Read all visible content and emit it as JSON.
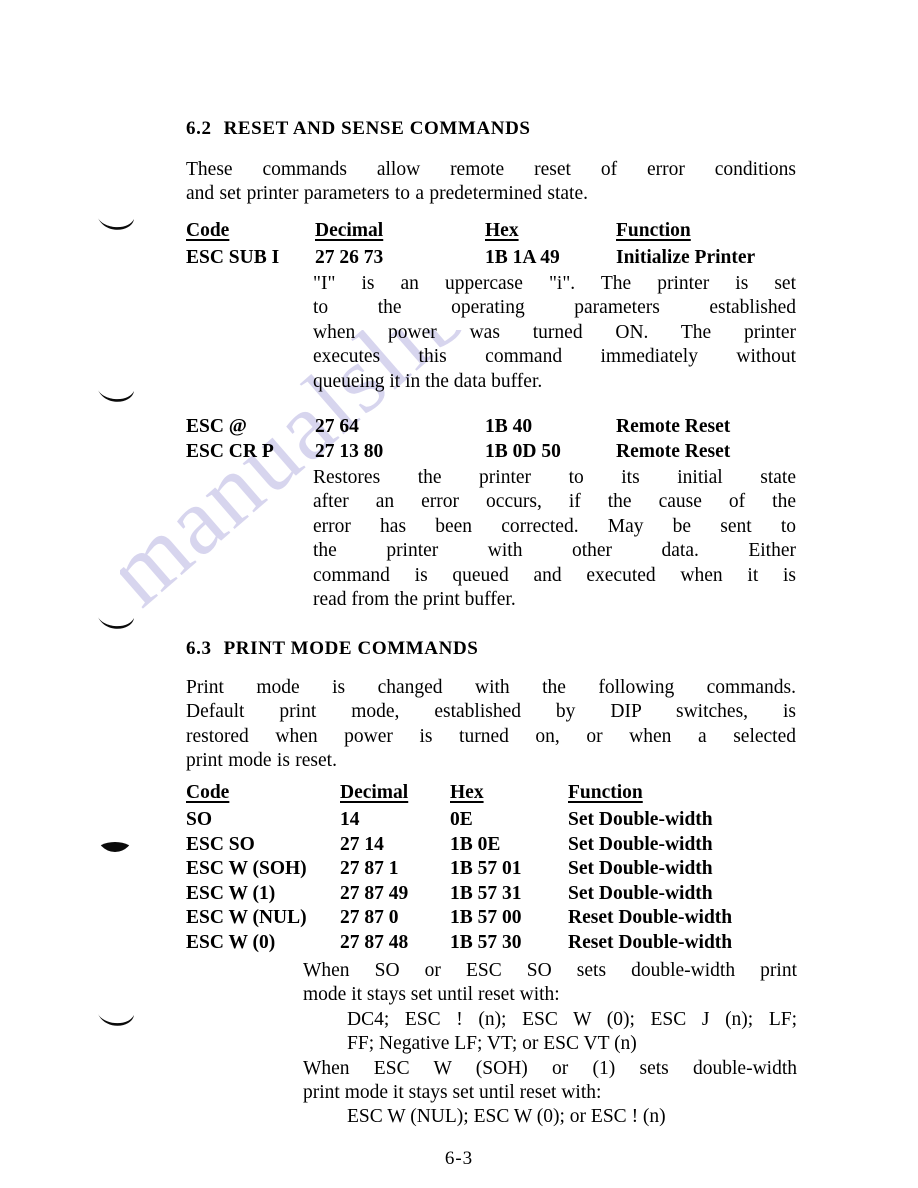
{
  "watermark": {
    "text": "manualslib.com"
  },
  "footer": {
    "page_number": "6-3"
  },
  "sections": {
    "reset_sense": {
      "number": "6.2",
      "title": "RESET AND SENSE COMMANDS",
      "intro": {
        "line1": "These commands allow remote reset of error conditions",
        "line2": "and set printer parameters to a predetermined state."
      },
      "table": {
        "headers": {
          "code": "Code",
          "decimal": "Decimal",
          "hex": "Hex",
          "function": "Function"
        },
        "rows": [
          {
            "code": "ESC SUB I",
            "decimal": "27 26 73",
            "hex": "1B 1A 49",
            "function": "Initialize Printer"
          }
        ],
        "rows2": [
          {
            "code": "ESC @",
            "decimal": "27 64",
            "hex": "1B 40",
            "function": "Remote Reset"
          },
          {
            "code": "ESC CR P",
            "decimal": "27 13 80",
            "hex": "1B 0D 50",
            "function": "Remote Reset"
          }
        ]
      },
      "note1": {
        "line1": "\"I\" is an uppercase \"i\".  The printer is set",
        "line2": "to the operating parameters established",
        "line3": "when power was turned ON.  The printer",
        "line4": "executes this command immediately without",
        "line5": "queueing it in the data buffer."
      },
      "note2": {
        "line1": "Restores the printer to its initial state",
        "line2": "after an error occurs, if the cause of the",
        "line3": "error has been corrected.  May be sent to",
        "line4": "the printer with other data.  Either",
        "line5": "command is queued and executed when it is",
        "line6": "read from the print buffer."
      }
    },
    "print_mode": {
      "number": "6.3",
      "title": "PRINT MODE COMMANDS",
      "intro": {
        "line1": "Print mode is changed with the following commands.",
        "line2": "Default print mode, established by DIP switches, is",
        "line3": "restored when power is turned on, or when a selected",
        "line4": "print mode is reset."
      },
      "table": {
        "headers": {
          "code": "Code",
          "decimal": "Decimal",
          "hex": "Hex",
          "function": "Function"
        },
        "rows": [
          {
            "code": "SO",
            "decimal": "14",
            "hex": "0E",
            "function": "Set Double-width"
          },
          {
            "code": "ESC SO",
            "decimal": "27 14",
            "hex": "1B 0E",
            "function": "Set Double-width"
          },
          {
            "code": "ESC W (SOH)",
            "decimal": "27 87 1",
            "hex": "1B 57 01",
            "function": "Set Double-width"
          },
          {
            "code": "ESC W (1)",
            "decimal": "27 87 49",
            "hex": "1B 57 31",
            "function": "Set Double-width"
          },
          {
            "code": "ESC W (NUL)",
            "decimal": "27 87 0",
            "hex": "1B 57 00",
            "function": "Reset Double-width"
          },
          {
            "code": "ESC W (0)",
            "decimal": "27 87 48",
            "hex": "1B 57 30",
            "function": "Reset Double-width"
          }
        ]
      },
      "note": {
        "line1": "When SO or ESC SO sets double-width print",
        "line2": "mode it stays set until reset with:",
        "line3": "DC4;  ESC ! (n);  ESC W (0);  ESC J (n);  LF;",
        "line4": "FF; Negative LF; VT; or ESC VT (n)",
        "line5": "When ESC W (SOH) or (1) sets double-width",
        "line6": "print mode it stays set until reset with:",
        "line7": "ESC W (NUL); ESC W (0); or ESC ! (n)"
      }
    }
  }
}
